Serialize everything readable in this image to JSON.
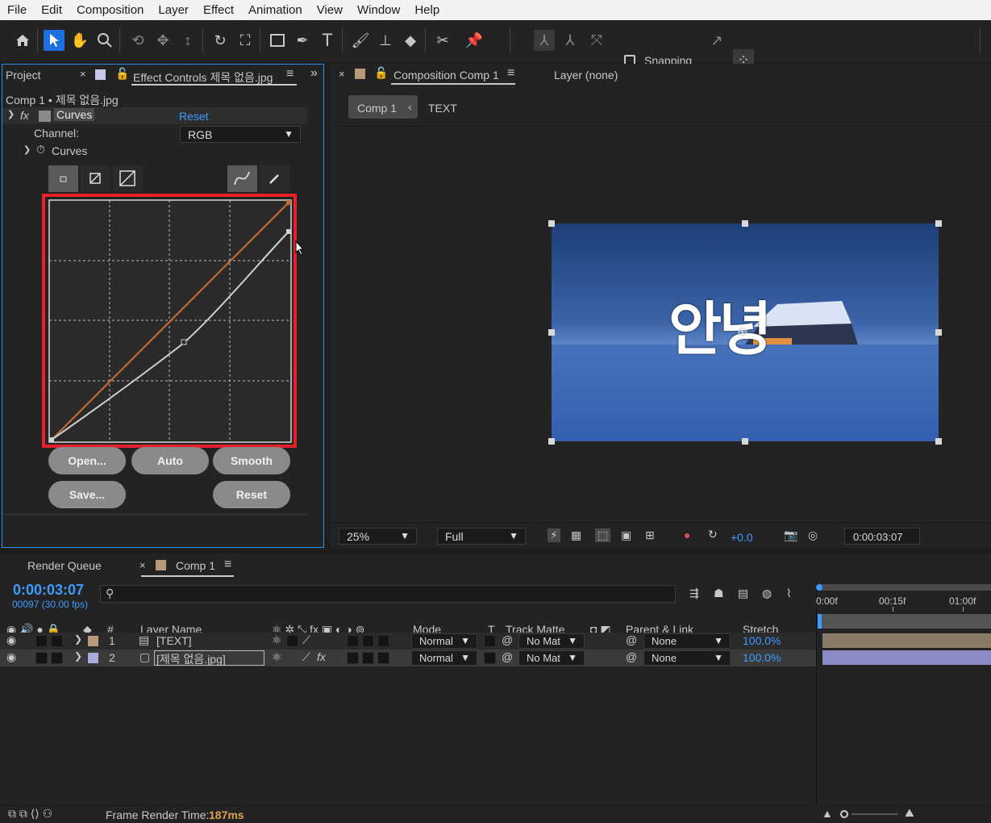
{
  "menu": [
    "File",
    "Edit",
    "Composition",
    "Layer",
    "Effect",
    "Animation",
    "View",
    "Window",
    "Help"
  ],
  "toolbar": {
    "snapping_label": "Snapping",
    "icons": [
      "home-icon",
      "selection-icon",
      "hand-icon",
      "zoom-icon",
      "orbit-icon",
      "pan-icon",
      "dolly-icon",
      "rotate-icon",
      "anchor-icon",
      "rectangle-icon",
      "pen-icon",
      "type-icon",
      "brush-icon",
      "stamp-icon",
      "eraser-icon",
      "roto-icon",
      "puppet-icon"
    ]
  },
  "left_panel": {
    "project_tab": "Project",
    "effect_tab": "Effect Controls 제목 없음.jpg",
    "breadcrumb": "Comp 1 • 제목 없음.jpg",
    "effect_name": "Curves",
    "reset_link": "Reset",
    "channel_label": "Channel:",
    "channel_value": "RGB",
    "curves_label": "Curves",
    "buttons": {
      "open": "Open...",
      "auto": "Auto",
      "smooth": "Smooth",
      "save": "Save...",
      "reset": "Reset"
    }
  },
  "comp_panel": {
    "tab": "Composition Comp 1",
    "layer_tab": "Layer (none)",
    "breadcrumb_comp": "Comp 1",
    "breadcrumb_layer": "TEXT",
    "overlay_text": "안녕",
    "zoom": "25%",
    "resolution": "Full",
    "exposure": "+0.0",
    "timecode": "0:00:03:07"
  },
  "timeline": {
    "render_queue_tab": "Render Queue",
    "comp_tab": "Comp 1",
    "current_time": "0:00:03:07",
    "frame_info": "00097 (30.00 fps)",
    "search_placeholder": "",
    "headers": {
      "num": "#",
      "layer_name": "Layer Name",
      "mode": "Mode",
      "t": "T",
      "track_matte": "Track Matte",
      "parent": "Parent & Link",
      "stretch": "Stretch"
    },
    "ruler": [
      "0:00f",
      "00:15f",
      "01:00f"
    ],
    "layers": [
      {
        "num": "1",
        "name": "[TEXT]",
        "mode": "Normal",
        "matte": "No Mat",
        "parent": "None",
        "stretch": "100.0%",
        "color": "#b89a78"
      },
      {
        "num": "2",
        "name": "[제목 없음.jpg]",
        "mode": "Normal",
        "matte": "No Mat",
        "parent": "None",
        "stretch": "100.0%",
        "color": "#aaaadd"
      }
    ],
    "footer_label": "Frame Render Time:",
    "footer_value": "187ms"
  },
  "colors": {
    "accent": "#1e6fe0",
    "link_blue": "#3d9bff",
    "highlight_red": "#e8202a",
    "curve_orange": "#c06a35",
    "footer_value": "#d9a04b"
  }
}
